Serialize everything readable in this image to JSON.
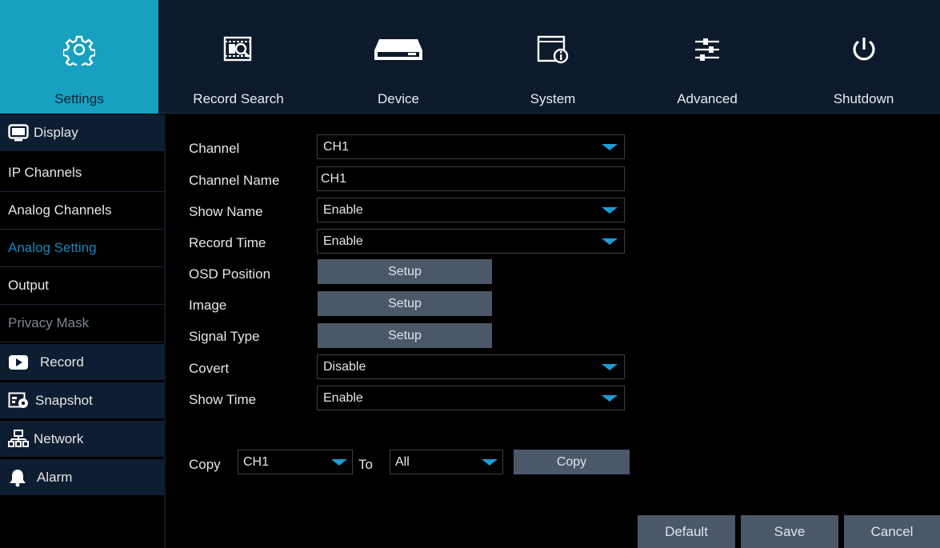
{
  "top_menu": [
    {
      "label": "Settings",
      "icon": "gear-icon",
      "active": true
    },
    {
      "label": "Record Search",
      "icon": "record-search-icon",
      "active": false
    },
    {
      "label": "Device",
      "icon": "hard-drive-icon",
      "active": false
    },
    {
      "label": "System",
      "icon": "system-info-icon",
      "active": false
    },
    {
      "label": "Advanced",
      "icon": "sliders-icon",
      "active": false
    },
    {
      "label": "Shutdown",
      "icon": "power-icon",
      "active": false
    }
  ],
  "sidebar": {
    "display": {
      "label": "Display",
      "icon": "monitor-icon"
    },
    "items": [
      {
        "label": "IP Channels"
      },
      {
        "label": "Analog Channels"
      },
      {
        "label": "Analog Setting",
        "selected": true
      },
      {
        "label": "Output"
      },
      {
        "label": "Privacy Mask",
        "disabled": true
      }
    ],
    "categories": [
      {
        "label": "Record",
        "icon": "record-icon"
      },
      {
        "label": "Snapshot",
        "icon": "snapshot-icon"
      },
      {
        "label": "Network",
        "icon": "network-icon"
      },
      {
        "label": "Alarm",
        "icon": "bell-icon"
      }
    ]
  },
  "form": {
    "channel": {
      "label": "Channel",
      "value": "CH1"
    },
    "channel_name": {
      "label": "Channel Name",
      "value": "CH1"
    },
    "show_name": {
      "label": "Show Name",
      "value": "Enable"
    },
    "record_time": {
      "label": "Record Time",
      "value": "Enable"
    },
    "osd_position": {
      "label": "OSD Position",
      "button": "Setup"
    },
    "image": {
      "label": "Image",
      "button": "Setup"
    },
    "signal_type": {
      "label": "Signal Type",
      "button": "Setup"
    },
    "covert": {
      "label": "Covert",
      "value": "Disable"
    },
    "show_time": {
      "label": "Show Time",
      "value": "Enable"
    }
  },
  "copy": {
    "label": "Copy",
    "from_value": "CH1",
    "to_label": "To",
    "to_value": "All",
    "button": "Copy"
  },
  "footer": {
    "default": "Default",
    "save": "Save",
    "cancel": "Cancel"
  },
  "colors": {
    "accent": "#17a0c0",
    "caret": "#1f9bd6",
    "button": "#4a5869",
    "topbar": "#0d1a2b",
    "selected_text": "#1a84b8"
  }
}
